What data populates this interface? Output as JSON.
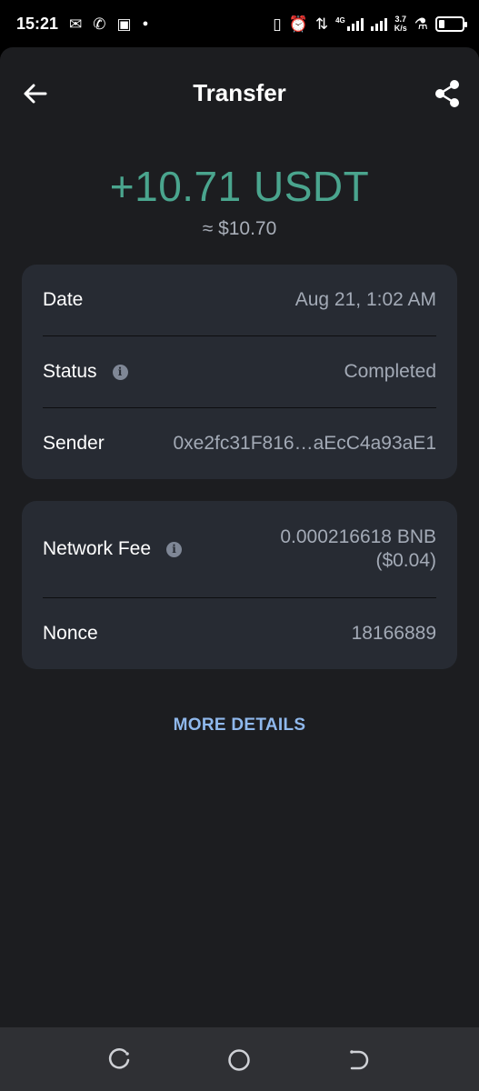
{
  "status_bar": {
    "time": "15:21",
    "network_label": "4G",
    "speed_value": "3.7",
    "speed_unit": "K/s"
  },
  "header": {
    "title": "Transfer"
  },
  "amount": {
    "value": "+10.71 USDT",
    "fiat": "≈ $10.70",
    "color": "#4aa58e"
  },
  "details": {
    "date_label": "Date",
    "date_value": "Aug 21, 1:02 AM",
    "status_label": "Status",
    "status_value": "Completed",
    "sender_label": "Sender",
    "sender_value": "0xe2fc31F816…aEcC4a93aE1"
  },
  "fees": {
    "fee_label": "Network Fee",
    "fee_value_line1": "0.000216618 BNB",
    "fee_value_line2": "($0.04)",
    "nonce_label": "Nonce",
    "nonce_value": "18166889"
  },
  "more_details": "MORE DETAILS",
  "icons": {
    "back": "arrow-left-icon",
    "share": "share-icon",
    "info": "info-icon",
    "nav_recent": "recents-icon",
    "nav_home": "home-icon",
    "nav_back": "back-nav-icon"
  }
}
